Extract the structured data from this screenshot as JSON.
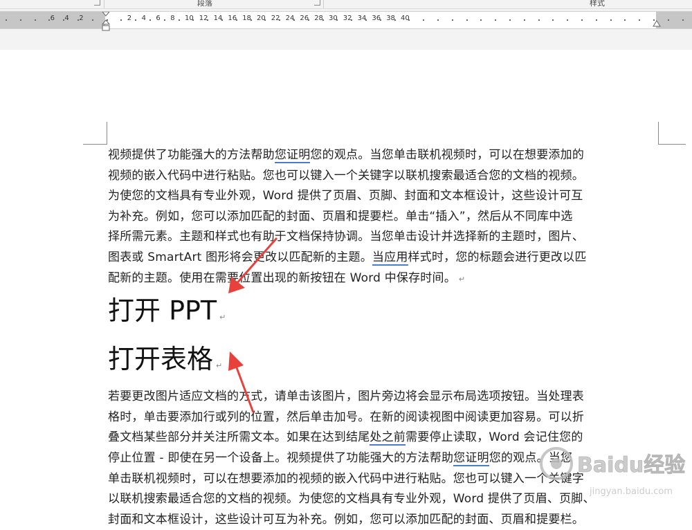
{
  "ribbon": {
    "group_paragraph": "段落",
    "group_styles": "样式"
  },
  "ruler": {
    "left_ticks": [
      "6",
      "4",
      "2"
    ],
    "right_ticks": [
      "2",
      "4",
      "6",
      "8",
      "10",
      "12",
      "14",
      "16",
      "18",
      "20",
      "22",
      "24",
      "26",
      "28",
      "30",
      "32",
      "34",
      "36",
      "38",
      "40"
    ]
  },
  "document": {
    "p1_lines": [
      "视频提供了功能强大的方法帮助您证明您的观点。当您单击联机视频时，可以在想要添加的",
      "视频的嵌入代码中进行粘贴。您也可以键入一个关键字以联机搜索最适合您的文档的视频。",
      "为使您的文档具有专业外观，Word 提供了页眉、页脚、封面和文本框设计，这些设计可互",
      "为补充。例如，您可以添加匹配的封面、页眉和提要栏。单击“插入”，然后从不同库中选",
      "择所需元素。主题和样式也有助于文档保持协调。当您单击设计并选择新的主题时，图片、",
      "图表或 SmartArt 图形将会更改以匹配新的主题。当应用样式时，您的标题会进行更改以匹",
      "配新的主题。使用在需要位置出现的新按钮在 Word 中保存时间。"
    ],
    "heading1": "打开 PPT",
    "heading2": "打开表格",
    "p2_lines": [
      "若要更改图片适应文档的方式，请单击该图片，图片旁边将会显示布局选项按钮。当处理表",
      "格时，单击要添加行或列的位置，然后单击加号。在新的阅读视图中阅读更加容易。可以折",
      "叠文档某些部分并关注所需文本。如果在达到结尾处之前需要停止读取，Word 会记住您的",
      "停止位置 - 即使在另一个设备上。视频提供了功能强大的方法帮助您证明您的观点。当您",
      "单击联机视频时，可以在想要添加的视频的嵌入代码中进行粘贴。您也可以键入一个关键字",
      "以联机搜索最适合您的文档的视频。为使您的文档具有专业外观，Word 提供了页眉、页脚、",
      "封面和文本框设计，这些设计可互为补充。例如，您可以添加匹配的封面、页眉和提要栏。"
    ],
    "para_mark": "↵",
    "heading_mark": "↵"
  },
  "watermark": {
    "text": "Baidu经验",
    "url_text": "jingyan.baidu.com"
  },
  "colors": {
    "arrow": "#e8403a",
    "underline": "#4a7cd0",
    "ruler_gray": "#c6c6c6"
  }
}
